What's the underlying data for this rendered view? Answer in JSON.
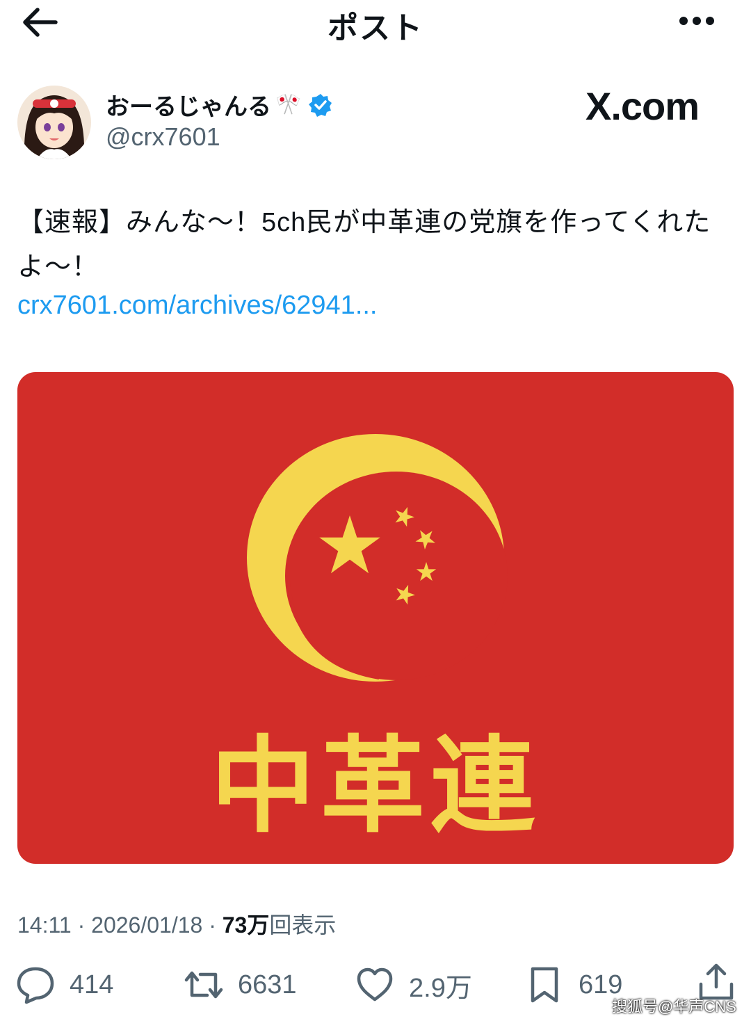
{
  "header": {
    "title": "ポスト"
  },
  "author": {
    "display_name": "おーるじゃんる",
    "name_emoji": "🎌",
    "handle": "@crx7601",
    "verified": true
  },
  "watermark": "X.com",
  "post": {
    "text": "【速報】みんな～！5ch民が中革連の党旗を作ってくれたよ～！",
    "link": "crx7601.com/archives/62941..."
  },
  "image": {
    "flag_label": "中革連",
    "colors": {
      "background": "#d22d29",
      "emblem": "#f5d64f"
    }
  },
  "meta": {
    "time": "14:11",
    "separator": " · ",
    "date": "2026/01/18",
    "views_count": "73万",
    "views_label": "回表示"
  },
  "actions": {
    "replies": "414",
    "reposts": "6631",
    "likes": "2.9万",
    "bookmarks": "619"
  },
  "source_watermark": "搜狐号@华声CNS",
  "colors": {
    "link": "#1d9bf0",
    "verified": "#1d9bf0",
    "muted": "#536471"
  },
  "icons": [
    "back-arrow-icon",
    "more-icon",
    "verified-badge-icon",
    "reply-icon",
    "repost-icon",
    "like-icon",
    "bookmark-icon",
    "share-icon"
  ]
}
